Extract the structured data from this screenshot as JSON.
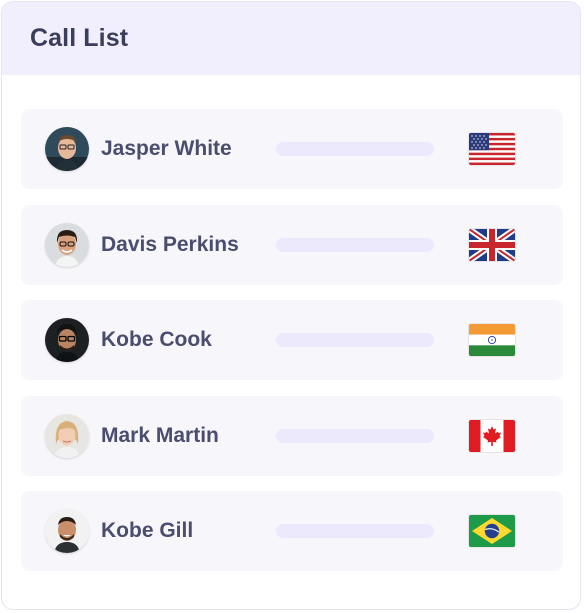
{
  "header": {
    "title": "Call List"
  },
  "calls": [
    {
      "name": "Jasper White",
      "country_flag": "us-flag-icon"
    },
    {
      "name": "Davis Perkins",
      "country_flag": "uk-flag-icon"
    },
    {
      "name": "Kobe Cook",
      "country_flag": "india-flag-icon"
    },
    {
      "name": "Mark Martin",
      "country_flag": "canada-flag-icon"
    },
    {
      "name": "Kobe Gill",
      "country_flag": "brazil-flag-icon"
    }
  ],
  "colors": {
    "header_bg": "#f1effd",
    "row_bg": "#f6f6fb",
    "bar": "#ebe9fb",
    "title_text": "#3a3d5c",
    "name_text": "#4a4d6e"
  }
}
